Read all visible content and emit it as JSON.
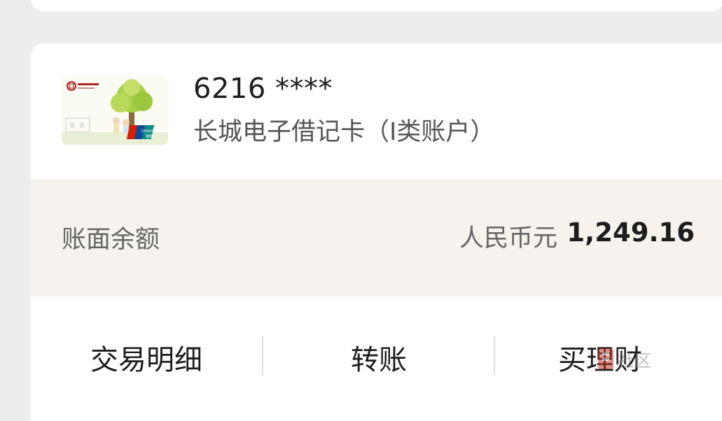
{
  "account": {
    "card_number": "6216 ****",
    "card_type": "长城电子借记卡（I类账户）",
    "card_image": {
      "bank_logo_icon": "bank-of-china-logo",
      "network_icon": "unionpay-logo",
      "network_text": "UnionPay 银联"
    }
  },
  "balance": {
    "label": "账面余额",
    "currency": "人民币元",
    "amount": "1,249.16"
  },
  "actions": [
    {
      "label": "交易明细"
    },
    {
      "label": "转账"
    },
    {
      "label": "买理财"
    }
  ],
  "watermark": {
    "text": "社区"
  },
  "colors": {
    "page_bg": "#ededed",
    "card_bg": "#ffffff",
    "balance_bg": "#f6f3ee",
    "primary_text": "#1d1d1d",
    "secondary_text": "#666666",
    "boc_red": "#b22222"
  }
}
